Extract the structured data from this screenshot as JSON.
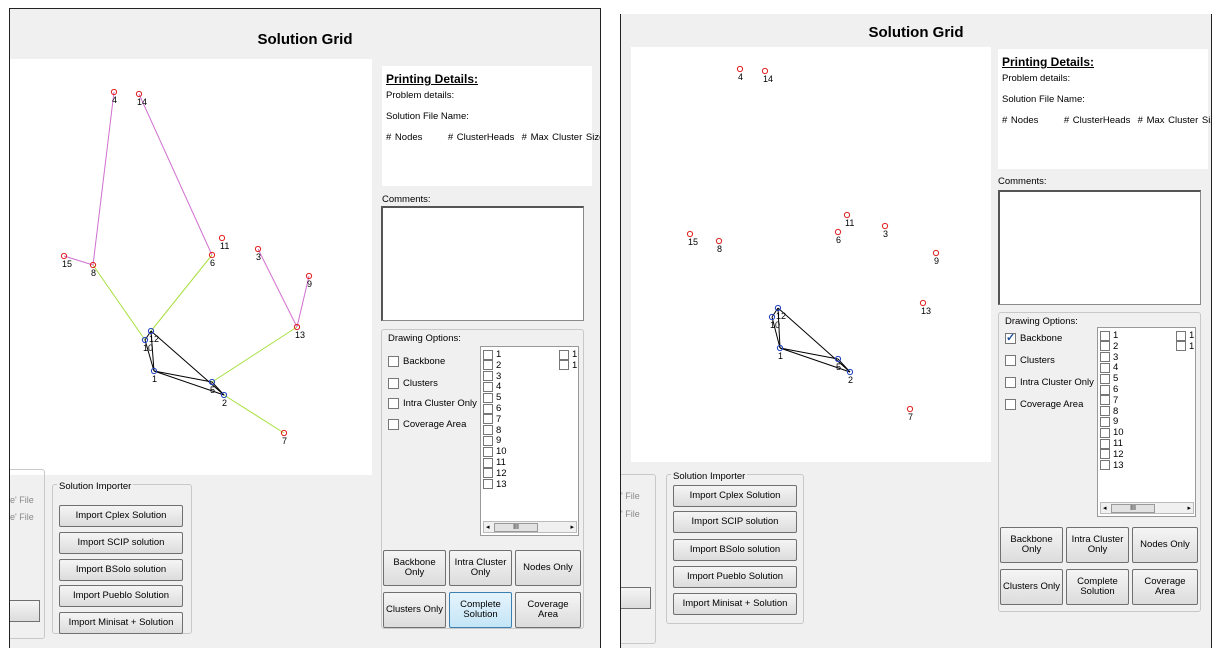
{
  "title": "Solution Grid",
  "details": {
    "heading": "Printing Details:",
    "problem": "Problem details:",
    "solution_file": "Solution File Name:",
    "nodes": "# Nodes",
    "cluster_heads": "# ClusterHeads",
    "max_cluster": "# Max Cluster Size"
  },
  "comments_label": "Comments:",
  "drawing": {
    "legend": "Drawing Options:",
    "backbone": "Backbone",
    "clusters": "Clusters",
    "intra": "Intra Cluster Only",
    "coverage": "Coverage Area",
    "node_labels": [
      "1",
      "2",
      "3",
      "4",
      "5",
      "6",
      "7",
      "8",
      "9",
      "10",
      "11",
      "12",
      "13"
    ],
    "col2_labels": [
      "1",
      "1"
    ],
    "scroll_thumb": "III"
  },
  "view_buttons": {
    "backbone_only": "Backbone Only",
    "intra_only": "Intra Cluster Only",
    "nodes_only": "Nodes Only",
    "clusters_only": "Clusters Only",
    "complete": "Complete Solution",
    "coverage": "Coverage Area"
  },
  "importer": {
    "legend": "Solution Importer",
    "cplex": "Import Cplex Solution",
    "scip": "Import SCIP solution",
    "bsolo": "Import BSolo solution",
    "pueblo": "Import Pueblo Solution",
    "minisat": "Import Minisat + Solution"
  },
  "left_stubs": [
    "e' File",
    "e' File"
  ],
  "left_stubs_b": [
    "' File",
    "' File"
  ],
  "colors": {
    "edge_pink": "#d070d0",
    "edge_green": "#a8e040",
    "edge_black": "#000000",
    "node_red": "#e02020",
    "node_blue": "#2040c0"
  },
  "graphA": {
    "nodes": [
      {
        "id": "4"
      },
      {
        "id": "14"
      },
      {
        "id": "11"
      },
      {
        "id": "6"
      },
      {
        "id": "3"
      },
      {
        "id": "9"
      },
      {
        "id": "15"
      },
      {
        "id": "8"
      },
      {
        "id": "13"
      },
      {
        "id": "12"
      },
      {
        "id": "10"
      },
      {
        "id": "1"
      },
      {
        "id": "5"
      },
      {
        "id": "2"
      },
      {
        "id": "7"
      }
    ]
  },
  "graphB": {
    "nodes": [
      {
        "id": "4"
      },
      {
        "id": "14"
      },
      {
        "id": "11"
      },
      {
        "id": "6"
      },
      {
        "id": "3"
      },
      {
        "id": "9"
      },
      {
        "id": "15"
      },
      {
        "id": "8"
      },
      {
        "id": "13"
      },
      {
        "id": "12"
      },
      {
        "id": "10"
      },
      {
        "id": "1"
      },
      {
        "id": "5"
      },
      {
        "id": "2"
      },
      {
        "id": "7"
      }
    ]
  }
}
